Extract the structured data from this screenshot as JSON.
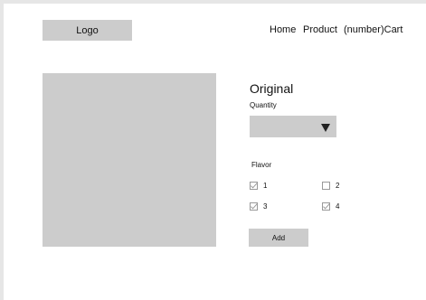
{
  "header": {
    "logo": "Logo",
    "nav": [
      "Home",
      "Product",
      "(number)Cart"
    ]
  },
  "product": {
    "title": "Original",
    "quantity_label": "Quantity",
    "quantity_value": "",
    "flavor_label": "Flavor",
    "flavors": [
      {
        "label": "1",
        "checked": true
      },
      {
        "label": "2",
        "checked": false
      },
      {
        "label": "3",
        "checked": true
      },
      {
        "label": "4",
        "checked": true
      }
    ],
    "add_label": "Add"
  },
  "colors": {
    "placeholder_gray": "#cccccc",
    "page_background": "#ffffff",
    "outer_background": "#e6e6e6",
    "checkbox_stroke": "#999999"
  }
}
